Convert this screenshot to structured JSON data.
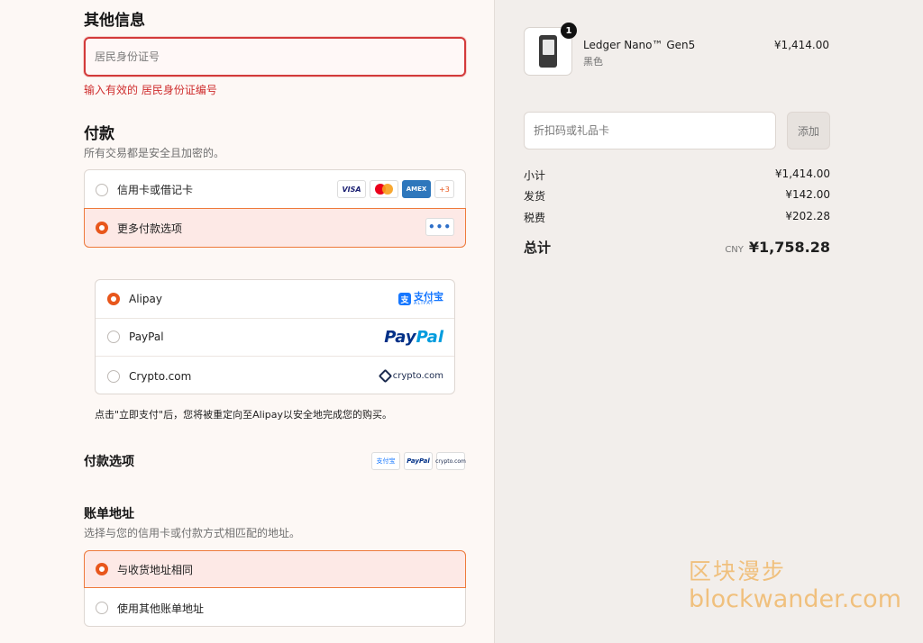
{
  "other_info": {
    "title": "其他信息",
    "id_placeholder": "居民身份证号",
    "id_error": "输入有效的 居民身份证编号"
  },
  "payment": {
    "title": "付款",
    "subtitle": "所有交易都是安全且加密的。",
    "options": [
      {
        "label": "信用卡或借记卡",
        "selected": false,
        "card_badges": [
          "VISA",
          "mastercard",
          "AMEX",
          "+3"
        ]
      },
      {
        "label": "更多付款选项",
        "selected": true,
        "more_icon": "•••"
      }
    ],
    "sub_options": [
      {
        "label": "Alipay",
        "selected": true,
        "logo_text": "支付宝",
        "logo_sub": "ALIPAY"
      },
      {
        "label": "PayPal",
        "selected": false,
        "logo_text_1": "Pay",
        "logo_text_2": "Pal"
      },
      {
        "label": "Crypto.com",
        "selected": false,
        "logo_text": "crypto.com"
      }
    ],
    "redirect_note": "点击\"立即支付\"后，您将被重定向至Alipay以安全地完成您的购买。"
  },
  "payment_options": {
    "title": "付款选项",
    "mini_logos": [
      "支付宝",
      "PayPal",
      "crypto.com"
    ]
  },
  "billing": {
    "title": "账单地址",
    "subtitle": "选择与您的信用卡或付款方式相匹配的地址。",
    "options": [
      {
        "label": "与收货地址相同",
        "selected": true
      },
      {
        "label": "使用其他账单地址",
        "selected": false
      }
    ]
  },
  "order": {
    "item": {
      "name": "Ledger Nano™ Gen5",
      "variant": "黑色",
      "price": "¥1,414.00",
      "quantity": "1"
    },
    "discount_placeholder": "折扣码或礼品卡",
    "add_label": "添加",
    "subtotal_label": "小计",
    "subtotal": "¥1,414.00",
    "shipping_label": "发货",
    "shipping": "¥142.00",
    "tax_label": "税费",
    "tax": "¥202.28",
    "total_label": "总计",
    "currency": "CNY",
    "total": "¥1,758.28"
  },
  "watermark": {
    "cn": "区块漫步",
    "en": "blockwander.com"
  },
  "colors": {
    "accent": "#e8571c",
    "error": "#cf2e2e",
    "selected_bg": "#fde9e6"
  }
}
